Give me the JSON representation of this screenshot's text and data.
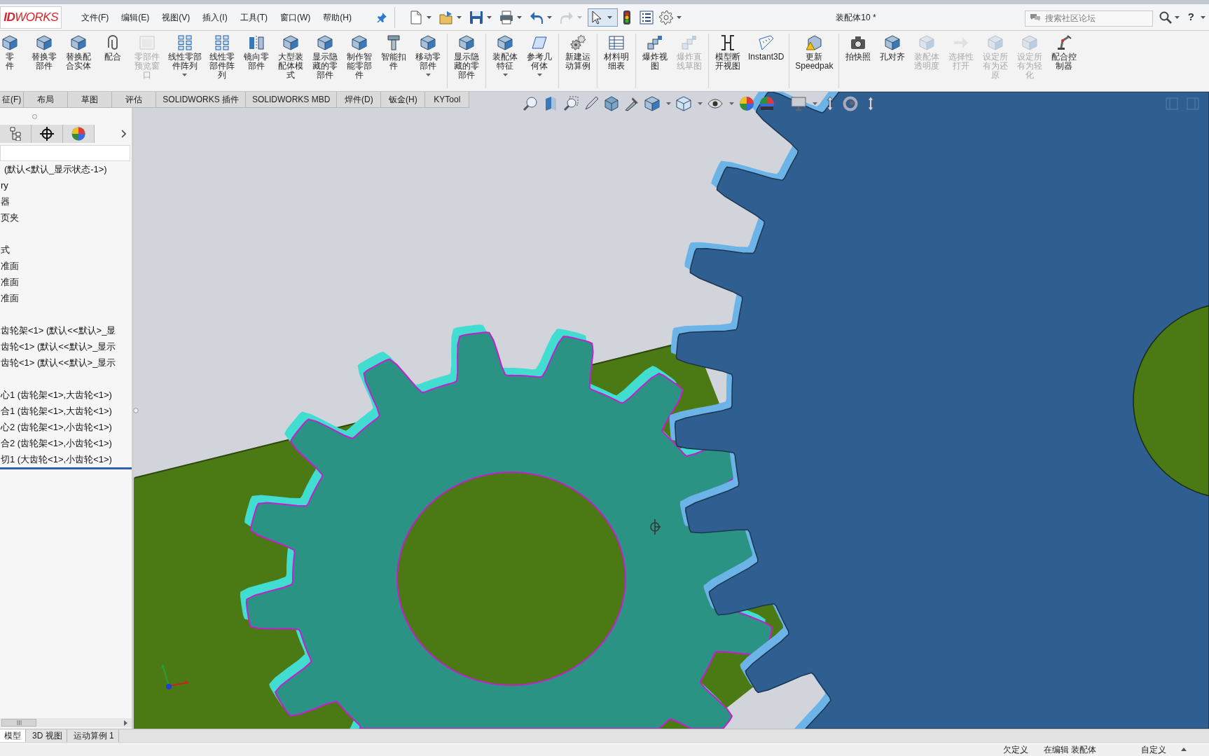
{
  "logo": "**ID**WORKS",
  "menu_bar": {
    "items": [
      "文件(F)",
      "编辑(E)",
      "视图(V)",
      "插入(I)",
      "工具(T)",
      "窗口(W)",
      "帮助(H)"
    ]
  },
  "quick_access": [
    {
      "dropdown": true,
      "disabled": false,
      "selected": false
    },
    {
      "dropdown": true,
      "disabled": false,
      "selected": false
    },
    {
      "dropdown": true,
      "disabled": false,
      "selected": false
    },
    {
      "dropdown": true,
      "disabled": false,
      "selected": false
    },
    {
      "dropdown": true,
      "disabled": false,
      "selected": false
    },
    {
      "dropdown": true,
      "disabled": true,
      "selected": false
    },
    {
      "dropdown": true,
      "disabled": false,
      "selected": true
    },
    {
      "dropdown": false,
      "disabled": false,
      "selected": false
    },
    {
      "dropdown": false,
      "disabled": false,
      "selected": false
    },
    {
      "dropdown": true,
      "disabled": false,
      "selected": false
    }
  ],
  "window": {
    "title": "装配体10 *"
  },
  "search": {
    "placeholder": "搜索社区论坛"
  },
  "help": {
    "label": "?"
  },
  "ribbon": {
    "groups": [
      {
        "buttons": [
          {
            "label": "零件",
            "disabled": false,
            "dropdown": false
          },
          {
            "label": "替换零部件",
            "disabled": false,
            "dropdown": false
          },
          {
            "label": "替换配合实体",
            "disabled": false,
            "dropdown": false
          },
          {
            "label": "配合",
            "disabled": false,
            "dropdown": false
          },
          {
            "label": "零部件预览窗口",
            "disabled": true,
            "dropdown": false
          },
          {
            "label": "线性零部件阵列",
            "disabled": false,
            "dropdown": true
          },
          {
            "label": "线性零部件阵列",
            "disabled": false,
            "dropdown": false
          },
          {
            "label": "镜向零部件",
            "disabled": false,
            "dropdown": false
          },
          {
            "label": "大型装配体模式",
            "disabled": false,
            "dropdown": false
          },
          {
            "label": "显示隐藏的零部件",
            "disabled": false,
            "dropdown": false
          },
          {
            "label": "制作智能零部件",
            "disabled": false,
            "dropdown": false
          },
          {
            "label": "智能扣件",
            "disabled": false,
            "dropdown": false
          },
          {
            "label": "移动零部件",
            "disabled": false,
            "dropdown": true
          }
        ]
      },
      {
        "buttons": [
          {
            "label": "显示隐藏的零部件",
            "disabled": false,
            "dropdown": false
          }
        ]
      },
      {
        "buttons": [
          {
            "label": "装配体特征",
            "disabled": false,
            "dropdown": true
          },
          {
            "label": "参考几何体",
            "disabled": false,
            "dropdown": true
          }
        ]
      },
      {
        "buttons": [
          {
            "label": "新建运动算例",
            "disabled": false,
            "dropdown": false
          }
        ]
      },
      {
        "buttons": [
          {
            "label": "材料明细表",
            "disabled": false,
            "dropdown": false
          }
        ]
      },
      {
        "buttons": [
          {
            "label": "爆炸视图",
            "disabled": false,
            "dropdown": false
          },
          {
            "label": "爆炸直线草图",
            "disabled": true,
            "dropdown": false
          }
        ]
      },
      {
        "buttons": [
          {
            "label": "模型断开视图",
            "disabled": false,
            "dropdown": false
          },
          {
            "label": "Instant3D",
            "disabled": false,
            "dropdown": false
          }
        ]
      },
      {
        "buttons": [
          {
            "label": "更新Speedpak",
            "disabled": false,
            "dropdown": false
          }
        ]
      },
      {
        "buttons": [
          {
            "label": "拍快照",
            "disabled": false,
            "dropdown": false
          },
          {
            "label": "孔对齐",
            "disabled": false,
            "dropdown": false
          },
          {
            "label": "装配体透明度",
            "disabled": true,
            "dropdown": false
          },
          {
            "label": "选择性打开",
            "disabled": true,
            "dropdown": false
          },
          {
            "label": "设定所有为还原",
            "disabled": true,
            "dropdown": false
          },
          {
            "label": "设定所有为轻化",
            "disabled": true,
            "dropdown": false
          },
          {
            "label": "配合控制器",
            "disabled": false,
            "dropdown": false
          }
        ]
      }
    ]
  },
  "tabs": [
    {
      "label": "征(F)",
      "selected": false
    },
    {
      "label": "布局",
      "selected": false
    },
    {
      "label": "草图",
      "selected": false
    },
    {
      "label": "评估",
      "selected": false
    },
    {
      "label": "SOLIDWORKS 插件",
      "selected": false
    },
    {
      "label": "SOLIDWORKS MBD",
      "selected": false
    },
    {
      "label": "焊件(D)",
      "selected": false
    },
    {
      "label": "钣金(H)",
      "selected": false
    },
    {
      "label": "KYTool",
      "selected": false
    }
  ],
  "feature_tree": {
    "groups": [
      {
        "items": [
          "(默认<默认_显示状态-1>)",
          "ry",
          "器",
          "页夹"
        ]
      },
      {
        "items": [
          "式",
          "准面",
          "准面",
          "准面"
        ]
      },
      {
        "items": [
          "齿轮架<1> (默认<<默认>_显",
          "齿轮<1> (默认<<默认>_显示",
          "齿轮<1> (默认<<默认>_显示"
        ]
      },
      {
        "items": [
          "心1 (齿轮架<1>,大齿轮<1>)",
          "合1 (齿轮架<1>,大齿轮<1>)",
          "心2 (齿轮架<1>,小齿轮<1>)",
          "合2 (齿轮架<1>,小齿轮<1>)",
          "切1 (大齿轮<1>,小齿轮<1>)"
        ]
      }
    ]
  },
  "bottom_tabs": [
    {
      "label": "模型",
      "selected": true
    },
    {
      "label": "3D 视图",
      "selected": false
    },
    {
      "label": "运动算例 1",
      "selected": false
    }
  ],
  "status_bar": {
    "items": [
      "欠定义",
      "在编辑 装配体",
      "自定义"
    ]
  }
}
